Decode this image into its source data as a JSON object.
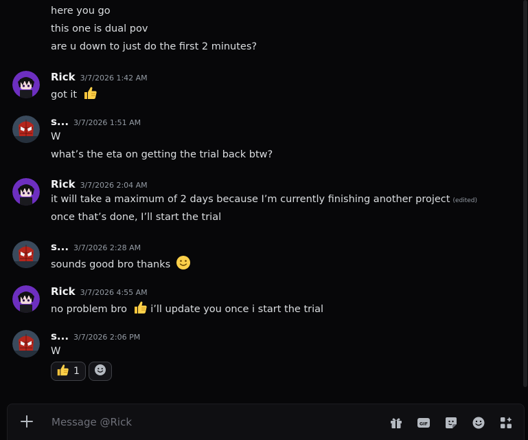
{
  "messages": {
    "cont_top": [
      "here you go",
      "this one is dual pov",
      "are u down to just do the first 2 minutes?"
    ],
    "g1": {
      "author": "Rick",
      "timestamp": "3/7/2026 1:42 AM",
      "lines": [
        "got it"
      ]
    },
    "g2": {
      "author": "s...",
      "timestamp": "3/7/2026 1:51 AM",
      "lines": [
        "W",
        "what’s the eta on getting the trial back btw?"
      ]
    },
    "g3": {
      "author": "Rick",
      "timestamp": "3/7/2026 2:04 AM",
      "lines": [
        "it will take a maximum of 2 days because I’m currently finishing another project",
        "once that’s done, I’ll start the trial"
      ],
      "edited": "(edited)"
    },
    "g4": {
      "author": "s...",
      "timestamp": "3/7/2026 2:28 AM",
      "lines": [
        "sounds good bro thanks"
      ]
    },
    "g5": {
      "author": "Rick",
      "timestamp": "3/7/2026 4:55 AM",
      "lines": [
        "no problem bro",
        "i’ll update you once i start the trial"
      ]
    },
    "g6": {
      "author": "s...",
      "timestamp": "3/7/2026 2:06 PM",
      "lines": [
        "W"
      ],
      "reactions": [
        {
          "emoji": "thumbs-up",
          "count": "1"
        }
      ]
    }
  },
  "composer": {
    "placeholder": "Message @Rick"
  },
  "icons": [
    "plus-icon",
    "gift-icon",
    "gif-icon",
    "sticker-icon",
    "emoji-icon",
    "apps-icon",
    "thumbs-up-emoji",
    "slight-smile-emoji",
    "add-reaction-icon"
  ],
  "colors": {
    "background": "#070709",
    "text": "#dbdee1",
    "timestamp": "#949ba4",
    "rick_avatar": "#6d2fc0",
    "spider_avatar": "#b5261d"
  }
}
